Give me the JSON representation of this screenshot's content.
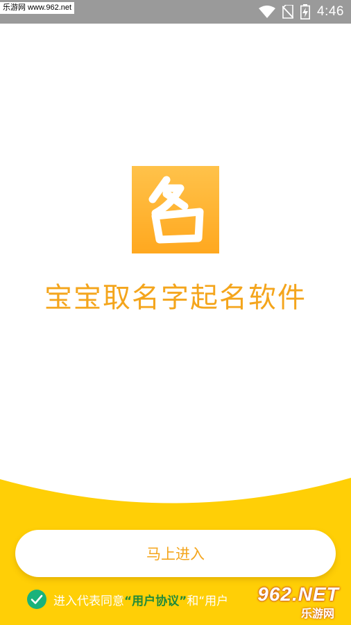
{
  "status_bar": {
    "watermark": "乐游网 www.962.net",
    "time": "4:46",
    "icons": [
      "wifi-icon",
      "no-sim-icon",
      "battery-charging-icon"
    ]
  },
  "logo": {
    "glyph": "名",
    "colors": {
      "top": "#ffc24a",
      "bottom": "#ffa81f"
    }
  },
  "app_name": "宝宝取名字起名软件",
  "enter_button": {
    "label": "马上进入"
  },
  "agreement": {
    "prefix": "进入代表同意",
    "link1": "“用户协议”",
    "conjunction": "和",
    "link2_partial": "“用户"
  },
  "corner_watermark": {
    "brand": "962.NET",
    "sub": "乐游网"
  },
  "colors": {
    "accent": "#f4a51c",
    "panel": "#ffcf06",
    "link": "#1f8a3a",
    "check": "#19b27b"
  }
}
